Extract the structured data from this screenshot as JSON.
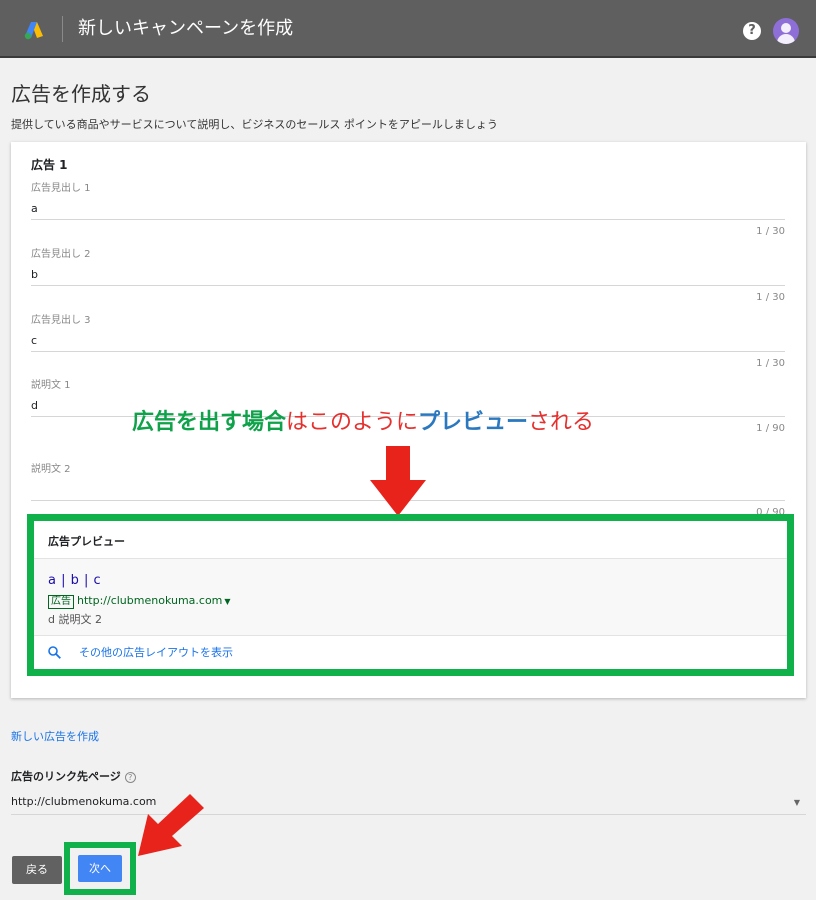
{
  "header": {
    "title": "新しいキャンペーンを作成",
    "help_icon": "?",
    "logo_colors": [
      "#4285f4",
      "#fbbc04",
      "#34a853"
    ]
  },
  "page": {
    "title": "広告を作成する",
    "subtitle": "提供している商品やサービスについて説明し、ビジネスのセールス ポイントをアピールしましょう"
  },
  "ad": {
    "number_label": "広告 1",
    "fields": [
      {
        "label": "広告見出し 1",
        "value": "a",
        "count": "1 / 30"
      },
      {
        "label": "広告見出し 2",
        "value": "b",
        "count": "1 / 30"
      },
      {
        "label": "広告見出し 3",
        "value": "c",
        "count": "1 / 30"
      },
      {
        "label": "説明文 1",
        "value": "d",
        "count": "1 / 90"
      },
      {
        "label": "説明文 2",
        "value": "",
        "count": "0 / 90"
      }
    ]
  },
  "preview": {
    "title": "広告プレビュー",
    "headline": "a | b | c",
    "ad_badge": "広告",
    "url": "http://clubmenokuma.com",
    "description": "d 説明文 2",
    "more_layouts": "その他の広告レイアウトを表示"
  },
  "annotation": {
    "part1": "広告を出す場合",
    "part2": "はこのように",
    "part3": "プレビュー",
    "part4": "される",
    "colors": {
      "green": "#10a24a",
      "red": "#e5302e",
      "blue": "#2a78c0",
      "frame": "#10b04a"
    }
  },
  "bottom": {
    "new_ad_link": "新しい広告を作成",
    "landing_page_label": "広告のリンク先ページ",
    "landing_page_help": "?",
    "landing_page_value": "http://clubmenokuma.com",
    "back_button": "戻る",
    "next_button": "次へ"
  }
}
